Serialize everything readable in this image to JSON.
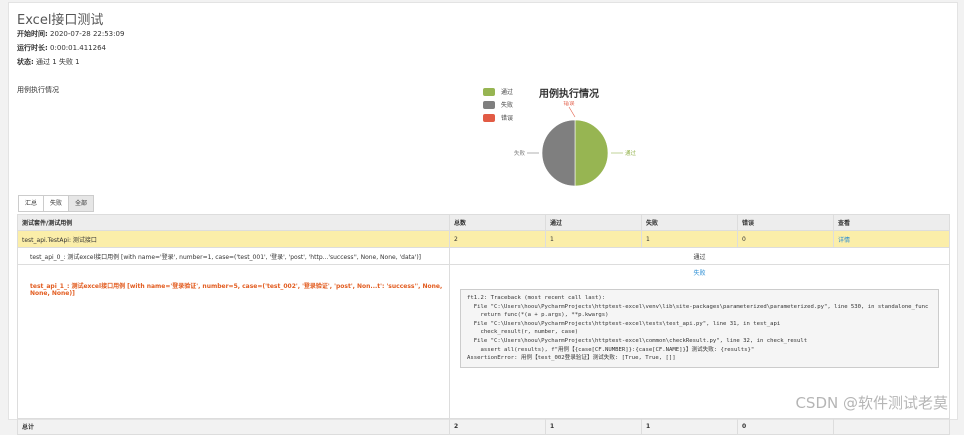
{
  "header": {
    "title": "Excel接口测试",
    "start_label": "开始时间:",
    "start_value": "2020-07-28 22:53:09",
    "run_label": "运行时长:",
    "run_value": "0:00:01.411264",
    "status_label": "状态:",
    "status_value": "通过 1 失败 1"
  },
  "chart_caption": "用例执行情况",
  "chart_data": {
    "type": "pie",
    "title": "用例执行情况",
    "categories": [
      "通过",
      "失败",
      "错误"
    ],
    "values": [
      1,
      1,
      0
    ],
    "colors": [
      "#97b552",
      "#7f7f7f",
      "#e25b45"
    ]
  },
  "filter_buttons": [
    "汇总",
    "失败",
    "全部"
  ],
  "table": {
    "columns": [
      "测试套件/测试用例",
      "总数",
      "通过",
      "失败",
      "错误",
      "查看"
    ],
    "suite": {
      "name": "test_api.TestApi: 测试接口",
      "total": "2",
      "pass": "1",
      "fail": "1",
      "error": "0",
      "view": "详情"
    },
    "case_pass": {
      "name": "test_api_0_: 测试excel接口用例 [with name='登录', number=1, case=('test_001', '登录', 'post', 'http...'success'', None, None, 'data')]",
      "status": "通过"
    },
    "case_fail": {
      "name": "test_api_1_: 测试excel接口用例 [with name='登录验证', number=5, case=('test_002', '登录验证', 'post', Non...t': 'success'', None, None, None)]",
      "status": "失败",
      "traceback": "ft1.2: Traceback (most recent call last):\n  File \"C:\\Users\\hoou\\PycharmProjects\\httptest-excel\\venv\\lib\\site-packages\\parameterized\\parameterized.py\", line 530, in standalone_func\n    return func(*(a + p.args), **p.kwargs)\n  File \"C:\\Users\\hoou\\PycharmProjects\\httptest-excel\\tests\\test_api.py\", line 31, in test_api\n    check_result(r, number, case)\n  File \"C:\\Users\\hoou\\PycharmProjects\\httptest-excel\\common\\checkResult.py\", line 32, in check_result\n    assert all(results), f\"用例【{case[CF.NUMBER]}:{case[CF.NAME]}】测试失败: {results}\"\nAssertionError: 用例【test_002登录验证】测试失败: [True, True, []]"
    },
    "total": {
      "label": "总计",
      "total": "2",
      "pass": "1",
      "fail": "1",
      "error": "0"
    }
  },
  "watermark": "CSDN @软件测试老莫"
}
